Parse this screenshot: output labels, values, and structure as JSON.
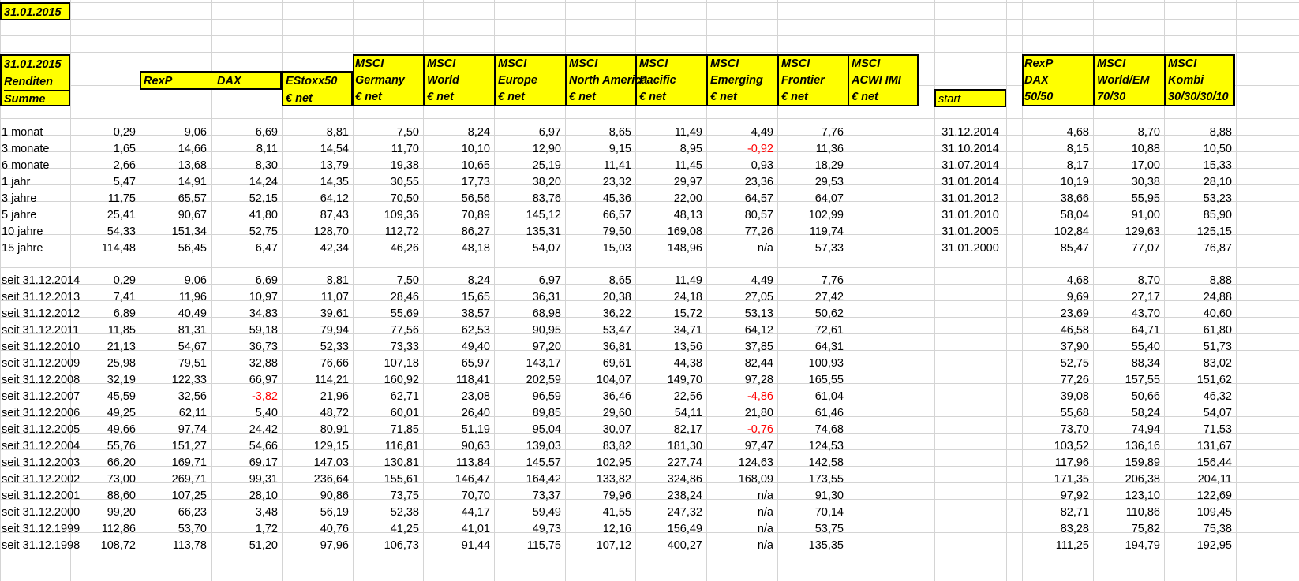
{
  "date_title": "31.01.2015",
  "left_header": {
    "line1": "31.01.2015",
    "line2": "Renditen",
    "line3": "Summe"
  },
  "columns": [
    {
      "line1": "",
      "line2": "RexP",
      "line3": ""
    },
    {
      "line1": "",
      "line2": "DAX",
      "line3": ""
    },
    {
      "line1": "",
      "line2": "EStoxx50",
      "line3": "€ net"
    },
    {
      "line1": "MSCI",
      "line2": "Germany",
      "line3": "€ net"
    },
    {
      "line1": "MSCI",
      "line2": "World",
      "line3": "€ net"
    },
    {
      "line1": "MSCI",
      "line2": "Europe",
      "line3": "€ net"
    },
    {
      "line1": "MSCI",
      "line2": "North America",
      "line3": "€ net"
    },
    {
      "line1": "MSCI",
      "line2": "Pacific",
      "line3": "€ net"
    },
    {
      "line1": "MSCI",
      "line2": "Emerging",
      "line3": "€ net"
    },
    {
      "line1": "MSCI",
      "line2": "Frontier",
      "line3": "€ net"
    },
    {
      "line1": "MSCI",
      "line2": "ACWI IMI",
      "line3": "€ net"
    }
  ],
  "start_label": "start",
  "combo_columns": [
    {
      "line1": "RexP",
      "line2": "DAX",
      "line3": "50/50"
    },
    {
      "line1": "MSCI",
      "line2": "World/EM",
      "line3": "70/30"
    },
    {
      "line1": "MSCI",
      "line2": "Kombi",
      "line3": "30/30/30/10"
    }
  ],
  "period_rows": [
    {
      "label": "1 monat",
      "values": [
        "0,29",
        "9,06",
        "6,69",
        "8,81",
        "7,50",
        "8,24",
        "6,97",
        "8,65",
        "11,49",
        "4,49",
        "7,76"
      ],
      "start": "31.12.2014",
      "combo": [
        "4,68",
        "8,70",
        "8,88"
      ]
    },
    {
      "label": "3 monate",
      "values": [
        "1,65",
        "14,66",
        "8,11",
        "14,54",
        "11,70",
        "10,10",
        "12,90",
        "9,15",
        "8,95",
        "-0,92",
        "11,36"
      ],
      "start": "31.10.2014",
      "combo": [
        "8,15",
        "10,88",
        "10,50"
      ]
    },
    {
      "label": "6 monate",
      "values": [
        "2,66",
        "13,68",
        "8,30",
        "13,79",
        "19,38",
        "10,65",
        "25,19",
        "11,41",
        "11,45",
        "0,93",
        "18,29"
      ],
      "start": "31.07.2014",
      "combo": [
        "8,17",
        "17,00",
        "15,33"
      ]
    },
    {
      "label": "1 jahr",
      "values": [
        "5,47",
        "14,91",
        "14,24",
        "14,35",
        "30,55",
        "17,73",
        "38,20",
        "23,32",
        "29,97",
        "23,36",
        "29,53"
      ],
      "start": "31.01.2014",
      "combo": [
        "10,19",
        "30,38",
        "28,10"
      ]
    },
    {
      "label": "3 jahre",
      "values": [
        "11,75",
        "65,57",
        "52,15",
        "64,12",
        "70,50",
        "56,56",
        "83,76",
        "45,36",
        "22,00",
        "64,57",
        "64,07"
      ],
      "start": "31.01.2012",
      "combo": [
        "38,66",
        "55,95",
        "53,23"
      ]
    },
    {
      "label": "5 jahre",
      "values": [
        "25,41",
        "90,67",
        "41,80",
        "87,43",
        "109,36",
        "70,89",
        "145,12",
        "66,57",
        "48,13",
        "80,57",
        "102,99"
      ],
      "start": "31.01.2010",
      "combo": [
        "58,04",
        "91,00",
        "85,90"
      ]
    },
    {
      "label": "10 jahre",
      "values": [
        "54,33",
        "151,34",
        "52,75",
        "128,70",
        "112,72",
        "86,27",
        "135,31",
        "79,50",
        "169,08",
        "77,26",
        "119,74"
      ],
      "start": "31.01.2005",
      "combo": [
        "102,84",
        "129,63",
        "125,15"
      ]
    },
    {
      "label": "15 jahre",
      "values": [
        "114,48",
        "56,45",
        "6,47",
        "42,34",
        "46,26",
        "48,18",
        "54,07",
        "15,03",
        "148,96",
        "n/a",
        "57,33"
      ],
      "start": "31.01.2000",
      "combo": [
        "85,47",
        "77,07",
        "76,87"
      ]
    }
  ],
  "since_rows": [
    {
      "label": "seit 31.12.2014",
      "values": [
        "0,29",
        "9,06",
        "6,69",
        "8,81",
        "7,50",
        "8,24",
        "6,97",
        "8,65",
        "11,49",
        "4,49",
        "7,76"
      ],
      "combo": [
        "4,68",
        "8,70",
        "8,88"
      ]
    },
    {
      "label": "seit 31.12.2013",
      "values": [
        "7,41",
        "11,96",
        "10,97",
        "11,07",
        "28,46",
        "15,65",
        "36,31",
        "20,38",
        "24,18",
        "27,05",
        "27,42"
      ],
      "combo": [
        "9,69",
        "27,17",
        "24,88"
      ]
    },
    {
      "label": "seit 31.12.2012",
      "values": [
        "6,89",
        "40,49",
        "34,83",
        "39,61",
        "55,69",
        "38,57",
        "68,98",
        "36,22",
        "15,72",
        "53,13",
        "50,62"
      ],
      "combo": [
        "23,69",
        "43,70",
        "40,60"
      ]
    },
    {
      "label": "seit 31.12.2011",
      "values": [
        "11,85",
        "81,31",
        "59,18",
        "79,94",
        "77,56",
        "62,53",
        "90,95",
        "53,47",
        "34,71",
        "64,12",
        "72,61"
      ],
      "combo": [
        "46,58",
        "64,71",
        "61,80"
      ]
    },
    {
      "label": "seit 31.12.2010",
      "values": [
        "21,13",
        "54,67",
        "36,73",
        "52,33",
        "73,33",
        "49,40",
        "97,20",
        "36,81",
        "13,56",
        "37,85",
        "64,31"
      ],
      "combo": [
        "37,90",
        "55,40",
        "51,73"
      ]
    },
    {
      "label": "seit 31.12.2009",
      "values": [
        "25,98",
        "79,51",
        "32,88",
        "76,66",
        "107,18",
        "65,97",
        "143,17",
        "69,61",
        "44,38",
        "82,44",
        "100,93"
      ],
      "combo": [
        "52,75",
        "88,34",
        "83,02"
      ]
    },
    {
      "label": "seit 31.12.2008",
      "values": [
        "32,19",
        "122,33",
        "66,97",
        "114,21",
        "160,92",
        "118,41",
        "202,59",
        "104,07",
        "149,70",
        "97,28",
        "165,55"
      ],
      "combo": [
        "77,26",
        "157,55",
        "151,62"
      ]
    },
    {
      "label": "seit 31.12.2007",
      "values": [
        "45,59",
        "32,56",
        "-3,82",
        "21,96",
        "62,71",
        "23,08",
        "96,59",
        "36,46",
        "22,56",
        "-4,86",
        "61,04"
      ],
      "combo": [
        "39,08",
        "50,66",
        "46,32"
      ]
    },
    {
      "label": "seit 31.12.2006",
      "values": [
        "49,25",
        "62,11",
        "5,40",
        "48,72",
        "60,01",
        "26,40",
        "89,85",
        "29,60",
        "54,11",
        "21,80",
        "61,46"
      ],
      "combo": [
        "55,68",
        "58,24",
        "54,07"
      ]
    },
    {
      "label": "seit 31.12.2005",
      "values": [
        "49,66",
        "97,74",
        "24,42",
        "80,91",
        "71,85",
        "51,19",
        "95,04",
        "30,07",
        "82,17",
        "-0,76",
        "74,68"
      ],
      "combo": [
        "73,70",
        "74,94",
        "71,53"
      ]
    },
    {
      "label": "seit 31.12.2004",
      "values": [
        "55,76",
        "151,27",
        "54,66",
        "129,15",
        "116,81",
        "90,63",
        "139,03",
        "83,82",
        "181,30",
        "97,47",
        "124,53"
      ],
      "combo": [
        "103,52",
        "136,16",
        "131,67"
      ]
    },
    {
      "label": "seit 31.12.2003",
      "values": [
        "66,20",
        "169,71",
        "69,17",
        "147,03",
        "130,81",
        "113,84",
        "145,57",
        "102,95",
        "227,74",
        "124,63",
        "142,58"
      ],
      "combo": [
        "117,96",
        "159,89",
        "156,44"
      ]
    },
    {
      "label": "seit 31.12.2002",
      "values": [
        "73,00",
        "269,71",
        "99,31",
        "236,64",
        "155,61",
        "146,47",
        "164,42",
        "133,82",
        "324,86",
        "168,09",
        "173,55"
      ],
      "combo": [
        "171,35",
        "206,38",
        "204,11"
      ]
    },
    {
      "label": "seit 31.12.2001",
      "values": [
        "88,60",
        "107,25",
        "28,10",
        "90,86",
        "73,75",
        "70,70",
        "73,37",
        "79,96",
        "238,24",
        "n/a",
        "91,30"
      ],
      "combo": [
        "97,92",
        "123,10",
        "122,69"
      ]
    },
    {
      "label": "seit 31.12.2000",
      "values": [
        "99,20",
        "66,23",
        "3,48",
        "56,19",
        "52,38",
        "44,17",
        "59,49",
        "41,55",
        "247,32",
        "n/a",
        "70,14"
      ],
      "combo": [
        "82,71",
        "110,86",
        "109,45"
      ]
    },
    {
      "label": "seit 31.12.1999",
      "values": [
        "112,86",
        "53,70",
        "1,72",
        "40,76",
        "41,25",
        "41,01",
        "49,73",
        "12,16",
        "156,49",
        "n/a",
        "53,75"
      ],
      "combo": [
        "83,28",
        "75,82",
        "75,38"
      ]
    },
    {
      "label": "seit 31.12.1998",
      "values": [
        "108,72",
        "113,78",
        "51,20",
        "97,96",
        "106,73",
        "91,44",
        "115,75",
        "107,12",
        "400,27",
        "n/a",
        "135,35"
      ],
      "combo": [
        "111,25",
        "194,79",
        "192,95"
      ]
    }
  ],
  "colors": {
    "highlight": "#ffff00",
    "negative": "#ff0000",
    "gridline": "#d4d4d4"
  }
}
